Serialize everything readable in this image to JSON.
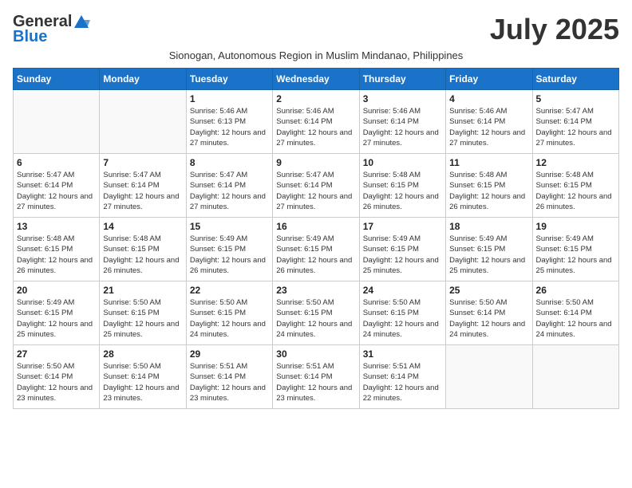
{
  "header": {
    "logo_general": "General",
    "logo_blue": "Blue",
    "month_title": "July 2025",
    "subtitle": "Sionogan, Autonomous Region in Muslim Mindanao, Philippines"
  },
  "days_of_week": [
    "Sunday",
    "Monday",
    "Tuesday",
    "Wednesday",
    "Thursday",
    "Friday",
    "Saturday"
  ],
  "weeks": [
    [
      {
        "day": "",
        "info": ""
      },
      {
        "day": "",
        "info": ""
      },
      {
        "day": "1",
        "info": "Sunrise: 5:46 AM\nSunset: 6:13 PM\nDaylight: 12 hours and 27 minutes."
      },
      {
        "day": "2",
        "info": "Sunrise: 5:46 AM\nSunset: 6:14 PM\nDaylight: 12 hours and 27 minutes."
      },
      {
        "day": "3",
        "info": "Sunrise: 5:46 AM\nSunset: 6:14 PM\nDaylight: 12 hours and 27 minutes."
      },
      {
        "day": "4",
        "info": "Sunrise: 5:46 AM\nSunset: 6:14 PM\nDaylight: 12 hours and 27 minutes."
      },
      {
        "day": "5",
        "info": "Sunrise: 5:47 AM\nSunset: 6:14 PM\nDaylight: 12 hours and 27 minutes."
      }
    ],
    [
      {
        "day": "6",
        "info": "Sunrise: 5:47 AM\nSunset: 6:14 PM\nDaylight: 12 hours and 27 minutes."
      },
      {
        "day": "7",
        "info": "Sunrise: 5:47 AM\nSunset: 6:14 PM\nDaylight: 12 hours and 27 minutes."
      },
      {
        "day": "8",
        "info": "Sunrise: 5:47 AM\nSunset: 6:14 PM\nDaylight: 12 hours and 27 minutes."
      },
      {
        "day": "9",
        "info": "Sunrise: 5:47 AM\nSunset: 6:14 PM\nDaylight: 12 hours and 27 minutes."
      },
      {
        "day": "10",
        "info": "Sunrise: 5:48 AM\nSunset: 6:15 PM\nDaylight: 12 hours and 26 minutes."
      },
      {
        "day": "11",
        "info": "Sunrise: 5:48 AM\nSunset: 6:15 PM\nDaylight: 12 hours and 26 minutes."
      },
      {
        "day": "12",
        "info": "Sunrise: 5:48 AM\nSunset: 6:15 PM\nDaylight: 12 hours and 26 minutes."
      }
    ],
    [
      {
        "day": "13",
        "info": "Sunrise: 5:48 AM\nSunset: 6:15 PM\nDaylight: 12 hours and 26 minutes."
      },
      {
        "day": "14",
        "info": "Sunrise: 5:48 AM\nSunset: 6:15 PM\nDaylight: 12 hours and 26 minutes."
      },
      {
        "day": "15",
        "info": "Sunrise: 5:49 AM\nSunset: 6:15 PM\nDaylight: 12 hours and 26 minutes."
      },
      {
        "day": "16",
        "info": "Sunrise: 5:49 AM\nSunset: 6:15 PM\nDaylight: 12 hours and 26 minutes."
      },
      {
        "day": "17",
        "info": "Sunrise: 5:49 AM\nSunset: 6:15 PM\nDaylight: 12 hours and 25 minutes."
      },
      {
        "day": "18",
        "info": "Sunrise: 5:49 AM\nSunset: 6:15 PM\nDaylight: 12 hours and 25 minutes."
      },
      {
        "day": "19",
        "info": "Sunrise: 5:49 AM\nSunset: 6:15 PM\nDaylight: 12 hours and 25 minutes."
      }
    ],
    [
      {
        "day": "20",
        "info": "Sunrise: 5:49 AM\nSunset: 6:15 PM\nDaylight: 12 hours and 25 minutes."
      },
      {
        "day": "21",
        "info": "Sunrise: 5:50 AM\nSunset: 6:15 PM\nDaylight: 12 hours and 25 minutes."
      },
      {
        "day": "22",
        "info": "Sunrise: 5:50 AM\nSunset: 6:15 PM\nDaylight: 12 hours and 24 minutes."
      },
      {
        "day": "23",
        "info": "Sunrise: 5:50 AM\nSunset: 6:15 PM\nDaylight: 12 hours and 24 minutes."
      },
      {
        "day": "24",
        "info": "Sunrise: 5:50 AM\nSunset: 6:15 PM\nDaylight: 12 hours and 24 minutes."
      },
      {
        "day": "25",
        "info": "Sunrise: 5:50 AM\nSunset: 6:14 PM\nDaylight: 12 hours and 24 minutes."
      },
      {
        "day": "26",
        "info": "Sunrise: 5:50 AM\nSunset: 6:14 PM\nDaylight: 12 hours and 24 minutes."
      }
    ],
    [
      {
        "day": "27",
        "info": "Sunrise: 5:50 AM\nSunset: 6:14 PM\nDaylight: 12 hours and 23 minutes."
      },
      {
        "day": "28",
        "info": "Sunrise: 5:50 AM\nSunset: 6:14 PM\nDaylight: 12 hours and 23 minutes."
      },
      {
        "day": "29",
        "info": "Sunrise: 5:51 AM\nSunset: 6:14 PM\nDaylight: 12 hours and 23 minutes."
      },
      {
        "day": "30",
        "info": "Sunrise: 5:51 AM\nSunset: 6:14 PM\nDaylight: 12 hours and 23 minutes."
      },
      {
        "day": "31",
        "info": "Sunrise: 5:51 AM\nSunset: 6:14 PM\nDaylight: 12 hours and 22 minutes."
      },
      {
        "day": "",
        "info": ""
      },
      {
        "day": "",
        "info": ""
      }
    ]
  ]
}
